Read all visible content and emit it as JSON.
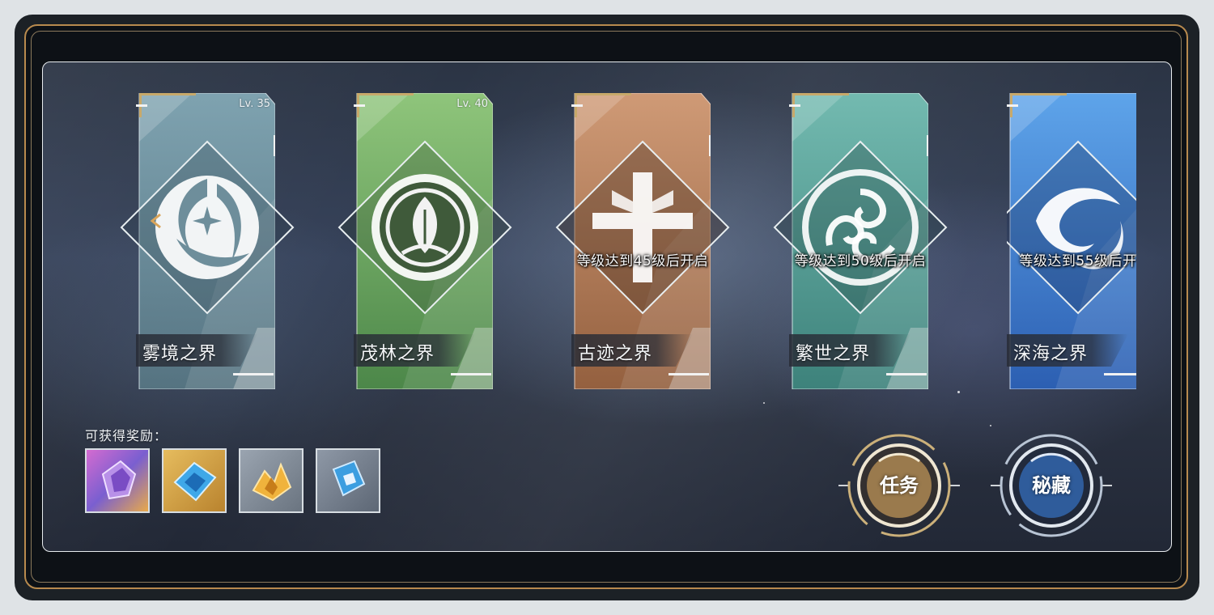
{
  "cards": [
    {
      "name": "雾境之界",
      "level": "Lv. 35",
      "lock_text": "",
      "theme": "mist",
      "color_top": "#7fa5b4",
      "color_bottom": "#5a7a88",
      "emblem": "mist-emblem-icon"
    },
    {
      "name": "茂林之界",
      "level": "Lv. 40",
      "lock_text": "",
      "theme": "forest",
      "color_top": "#8cc079",
      "color_bottom": "#4f8a4c",
      "emblem": "leaf-emblem-icon"
    },
    {
      "name": "古迹之界",
      "level": "",
      "lock_text": "等级达到45级后开启",
      "theme": "ruins",
      "color_top": "#c99573",
      "color_bottom": "#9a6447",
      "emblem": "cross-emblem-icon"
    },
    {
      "name": "繁世之界",
      "level": "",
      "lock_text": "等级达到50级后开启",
      "theme": "prosperity",
      "color_top": "#6fb6ad",
      "color_bottom": "#3f8780",
      "emblem": "spiral-emblem-icon"
    },
    {
      "name": "深海之界",
      "level": "",
      "lock_text": "等级达到55级后开",
      "theme": "deepsea",
      "color_top": "#5b9fe4",
      "color_bottom": "#2e62b6",
      "emblem": "wave-emblem-icon"
    }
  ],
  "rewards": {
    "label": "可获得奖励：",
    "items": [
      {
        "icon": "purple-crystal-icon",
        "bg": "#b57ad0"
      },
      {
        "icon": "blue-crystal-icon",
        "bg": "#d9ac4f"
      },
      {
        "icon": "gold-crystal-icon",
        "bg": "#8c96a3"
      },
      {
        "icon": "blue-cube-icon",
        "bg": "#7d8896"
      }
    ]
  },
  "buttons": {
    "task": {
      "label": "任务",
      "accent": "#c9a468"
    },
    "secret": {
      "label": "秘藏",
      "accent": "#4a7bc0"
    }
  }
}
